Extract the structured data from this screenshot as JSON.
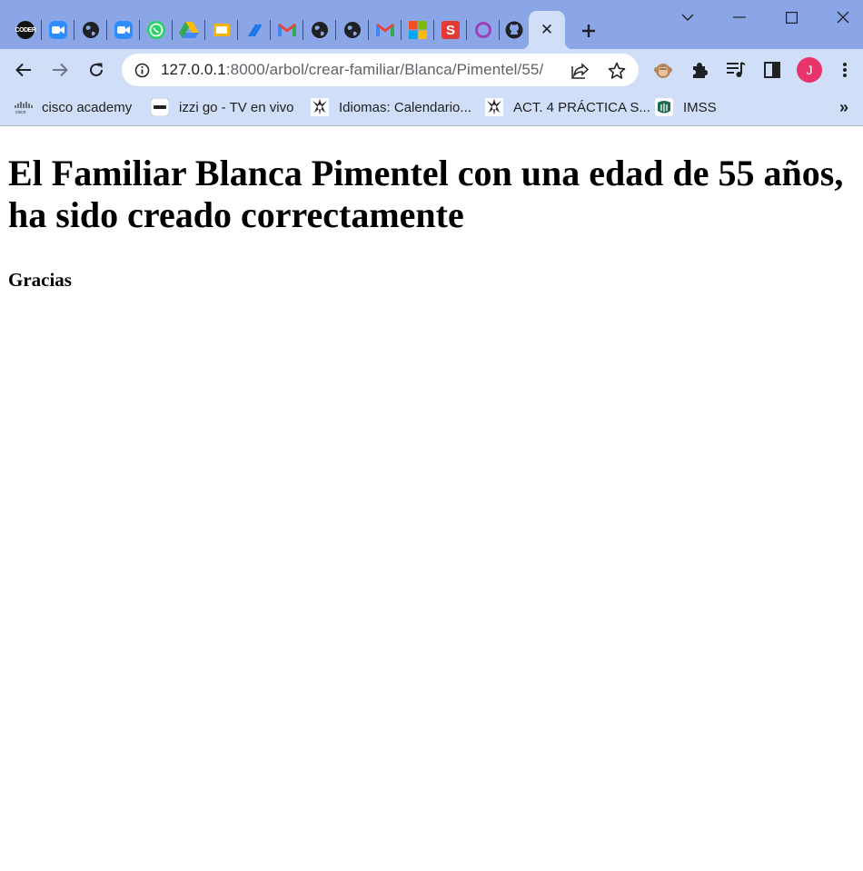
{
  "browser": {
    "tabs": [
      {
        "icon": "coder-icon",
        "label": "CODER"
      },
      {
        "icon": "zoom-icon",
        "label": ""
      },
      {
        "icon": "globe-icon",
        "label": ""
      },
      {
        "icon": "zoom-icon",
        "label": ""
      },
      {
        "icon": "whatsapp-icon",
        "label": ""
      },
      {
        "icon": "google-drive-icon",
        "label": ""
      },
      {
        "icon": "google-slides-icon",
        "label": ""
      },
      {
        "icon": "pen-app-icon",
        "label": ""
      },
      {
        "icon": "gmail-icon",
        "label": ""
      },
      {
        "icon": "globe-icon",
        "label": ""
      },
      {
        "icon": "globe-icon",
        "label": ""
      },
      {
        "icon": "gmail-icon",
        "label": ""
      },
      {
        "icon": "microsoft-icon",
        "label": ""
      },
      {
        "icon": "s-app-icon",
        "label": "S"
      },
      {
        "icon": "ring-icon",
        "label": ""
      },
      {
        "icon": "github-icon",
        "label": ""
      }
    ],
    "active_tab_close": "✕",
    "new_tab": "+",
    "url": {
      "host": "127.0.0.1",
      "path": ":8000/arbol/crear-familiar/Blanca/Pimentel/55/"
    },
    "profile_initial": "J",
    "bookmarks": [
      {
        "icon": "cisco-icon",
        "label": "cisco academy"
      },
      {
        "icon": "izzi-icon",
        "label": "izzi go - TV en vivo"
      },
      {
        "icon": "school-crest-icon",
        "label": "Idiomas: Calendario..."
      },
      {
        "icon": "school-crest-icon",
        "label": "ACT. 4 PRÁCTICA S..."
      },
      {
        "icon": "imss-icon",
        "label": "IMSS"
      }
    ],
    "bookmarks_more": "»"
  },
  "page": {
    "heading": "El Familiar Blanca Pimentel con una edad de 55 años, ha sido creado correctamente",
    "subheading": "Gracias"
  },
  "colors": {
    "tabstrip": "#8ba6e6",
    "toolbar": "#d0def7",
    "profile": "#e8336b"
  }
}
